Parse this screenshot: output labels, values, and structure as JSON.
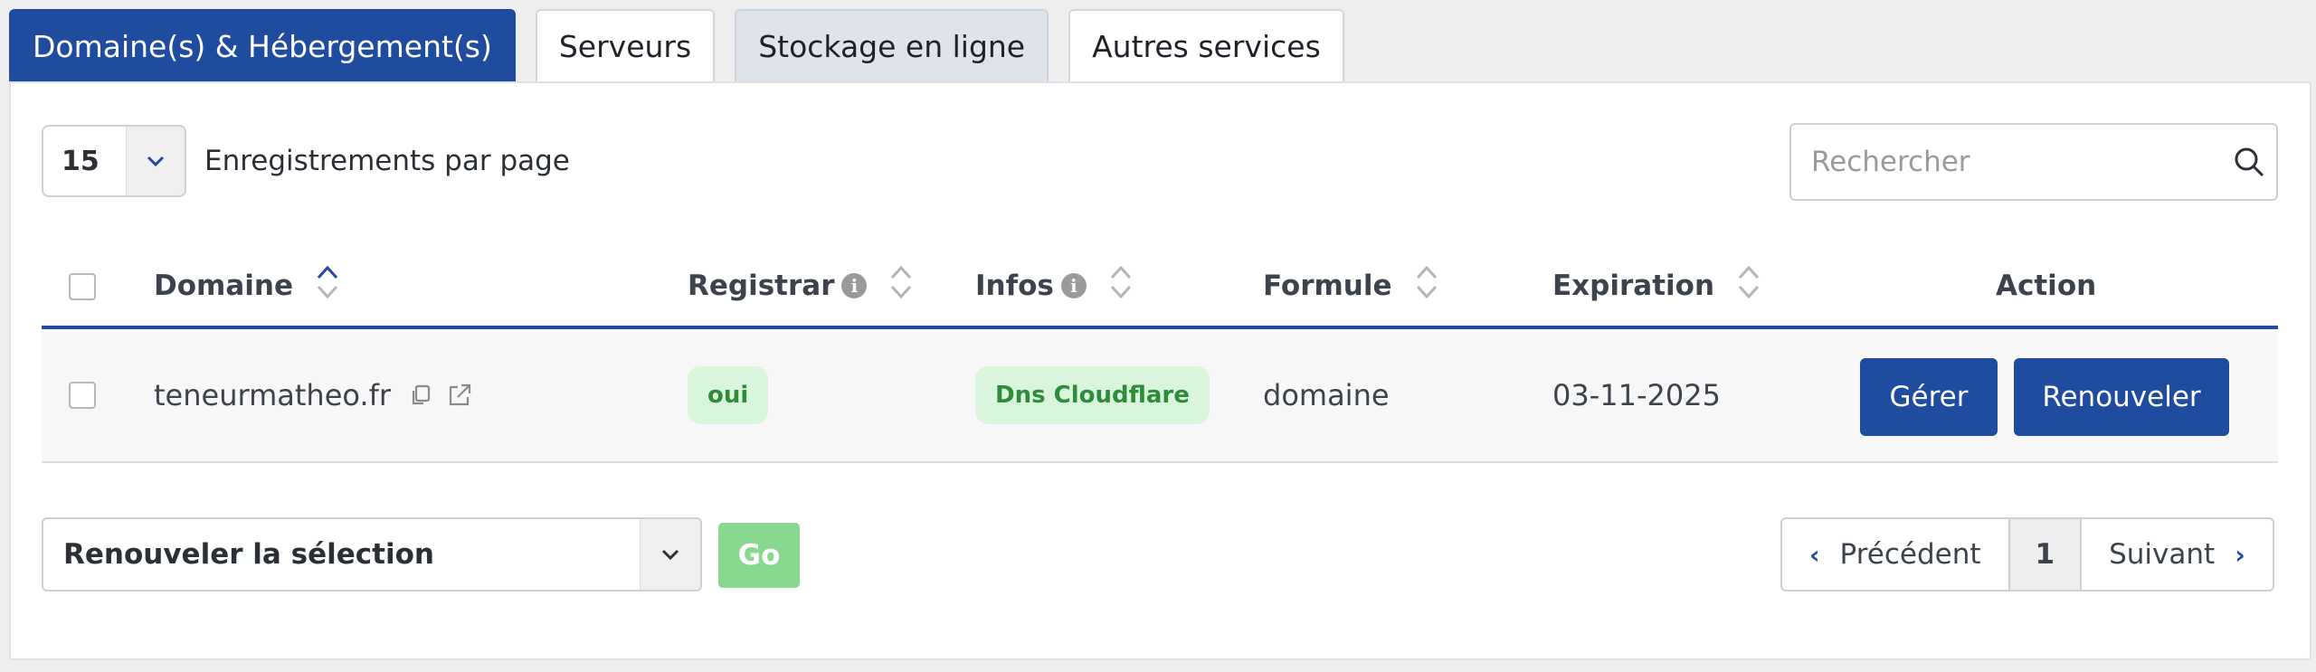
{
  "tabs": [
    {
      "label": "Domaine(s) & Hébergement(s)"
    },
    {
      "label": "Serveurs"
    },
    {
      "label": "Stockage en ligne"
    },
    {
      "label": "Autres services"
    }
  ],
  "per_page": {
    "value": "15",
    "label": "Enregistrements par page"
  },
  "search": {
    "placeholder": "Rechercher"
  },
  "table": {
    "headers": {
      "domain": "Domaine",
      "registrar": "Registrar",
      "infos": "Infos",
      "formula": "Formule",
      "expiration": "Expiration",
      "action": "Action"
    },
    "rows": [
      {
        "domain": "teneurmatheo.fr",
        "registrar": "oui",
        "infos": "Dns Cloudflare",
        "formula": "domaine",
        "expiration": "03-11-2025",
        "manage_label": "Gérer",
        "renew_label": "Renouveler"
      }
    ]
  },
  "bulk": {
    "selected": "Renouveler la sélection",
    "go_label": "Go"
  },
  "pagination": {
    "prev": "Précédent",
    "page": "1",
    "next": "Suivant"
  },
  "colors": {
    "primary": "#1f4c9e",
    "badge_bg": "#d9f5dc",
    "badge_text": "#2e8b3a",
    "go_bg": "#88d890"
  },
  "icons": [
    "chevron-down-icon",
    "search-icon",
    "sort-icon",
    "info-icon",
    "copy-icon",
    "external-link-icon",
    "chevron-left-icon",
    "chevron-right-icon"
  ]
}
